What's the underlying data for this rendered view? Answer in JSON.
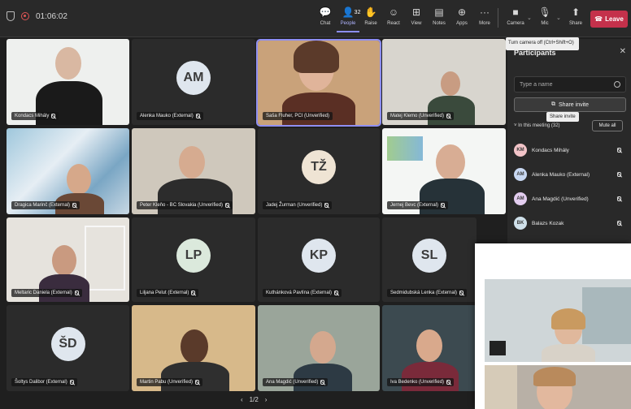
{
  "topbar": {
    "timer": "01:06:02",
    "people_count": "32",
    "tooltip": "Turn camera off (Ctrl+Shift+O)",
    "actions": [
      {
        "name": "chat",
        "label": "Chat",
        "icon": "chat-icon"
      },
      {
        "name": "people",
        "label": "People",
        "icon": "people-icon"
      },
      {
        "name": "raise",
        "label": "Raise",
        "icon": "hand-icon"
      },
      {
        "name": "react",
        "label": "React",
        "icon": "smiley-icon"
      },
      {
        "name": "view",
        "label": "View",
        "icon": "grid-icon"
      },
      {
        "name": "notes",
        "label": "Notes",
        "icon": "notes-icon"
      },
      {
        "name": "apps",
        "label": "Apps",
        "icon": "apps-icon"
      },
      {
        "name": "more",
        "label": "More",
        "icon": "more-icon"
      }
    ],
    "camera_label": "Camera",
    "mic_label": "Mic",
    "share_label": "Share",
    "leave_label": "Leave"
  },
  "tiles": [
    {
      "name": "Kondacs Mihály"
    },
    {
      "name": "Alenka Mauko (External)",
      "initials": "AM"
    },
    {
      "name": "Saša Fluher, PCI (Unverified)"
    },
    {
      "name": "Matej Klemo (Unverified)"
    },
    {
      "name": "Dragica Marinč (External)"
    },
    {
      "name": "Peter Kleňo - BC Slovakia (Unverified)"
    },
    {
      "name": "Jadej Žurman (Unverified)",
      "initials": "TŽ"
    },
    {
      "name": "Jernej Bevc (External)"
    },
    {
      "name": "Meltaric Daniela (External)"
    },
    {
      "name": "Liljana Pelut (External)",
      "initials": "LP"
    },
    {
      "name": "Kuthánková Pavlína (External)",
      "initials": "KP"
    },
    {
      "name": "Sedmidubská Lenka (External)",
      "initials": "SL"
    },
    {
      "name": "Šoltys Dalibor (External)",
      "initials": "ŠD"
    },
    {
      "name": "Martin Pabu (Unverified)"
    },
    {
      "name": "Ana Magdić (Unverified)"
    },
    {
      "name": "Iva Bedenko (Unverified)"
    }
  ],
  "pager": {
    "prev": "‹",
    "page": "1/2",
    "next": "›"
  },
  "panel": {
    "title": "Participants",
    "search_placeholder": "Type a name",
    "share_invite": "Share invite",
    "share_tooltip": "Share invite",
    "section": "In this meeting (32)",
    "mute_all": "Mute all",
    "participants": [
      {
        "initials": "KM",
        "name": "Kondacs Mihály"
      },
      {
        "initials": "AM",
        "name": "Alenka Mauko (External)"
      },
      {
        "initials": "AM",
        "name": "Ana Magdić (Unverified)"
      },
      {
        "initials": "BK",
        "name": "Balazs Kozak"
      }
    ]
  },
  "colors": {
    "accent": "#8b8ef5",
    "leave": "#c4314b",
    "bg": "#1f1f1f"
  }
}
